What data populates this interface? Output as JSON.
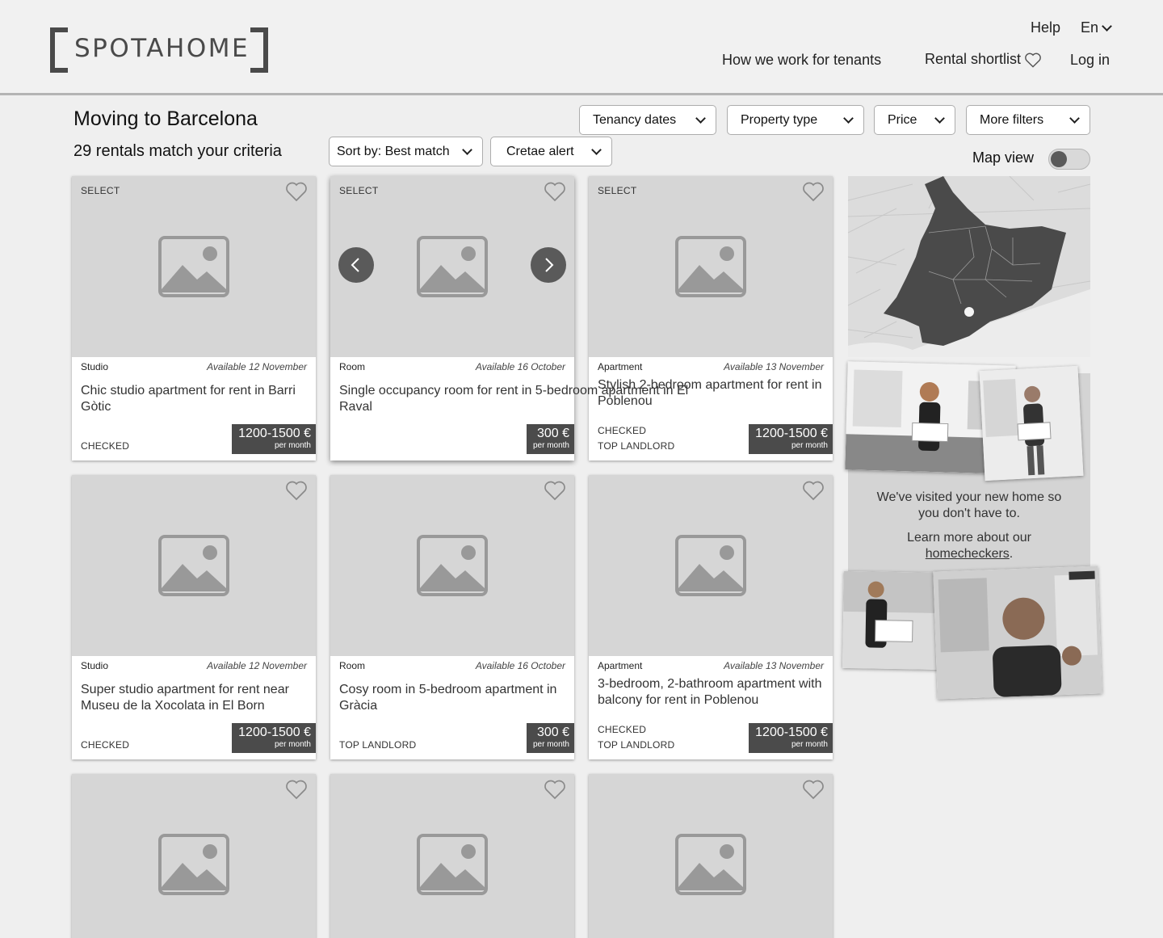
{
  "brand": {
    "logo_text": "SPOTAHOME"
  },
  "header": {
    "help": "Help",
    "language": "En",
    "how_we_work": "How we work for tenants",
    "shortlist": "Rental shortlist",
    "login": "Log in"
  },
  "toolbar": {
    "title": "Moving to Barcelona",
    "result_count": "29 rentals match your criteria",
    "filters": {
      "tenancy_dates": "Tenancy dates",
      "property_type": "Property type",
      "price": "Price",
      "more_filters": "More filters"
    },
    "sort_label": "Sort by: Best match",
    "alert_label": "Cretae alert",
    "map_view_label": "Map view",
    "map_view_on": false
  },
  "listings": [
    {
      "select": "SELECT",
      "type": "Studio",
      "available": "Available 12 November",
      "title": "Chic studio apartment for rent in Barri Gòtic",
      "tags": [
        "CHECKED"
      ],
      "price": "1200-1500 €",
      "per": "per month"
    },
    {
      "select": "SELECT",
      "type": "Room",
      "available": "Available 16 October",
      "title": "Single occupancy room for rent in 5-bedroom apartment in El Raval",
      "tags": [],
      "price": "300 €",
      "per": "per month"
    },
    {
      "select": "SELECT",
      "type": "Apartment",
      "available": "Available 13 November",
      "title": "Stylish 2-bedroom apartment for rent in Poblenou",
      "tags": [
        "CHECKED",
        "TOP LANDLORD"
      ],
      "price": "1200-1500 €",
      "per": "per month"
    },
    {
      "select": "",
      "type": "Studio",
      "available": "Available 12 November",
      "title": "Super studio apartment for rent near Museu de la Xocolata in El Born",
      "tags": [
        "CHECKED"
      ],
      "price": "1200-1500 €",
      "per": "per month"
    },
    {
      "select": "",
      "type": "Room",
      "available": "Available 16 October",
      "title": "Cosy room in 5-bedroom apartment in Gràcia",
      "tags": [
        "TOP LANDLORD"
      ],
      "price": "300 €",
      "per": "per month"
    },
    {
      "select": "",
      "type": "Apartment",
      "available": "Available 13 November",
      "title": "3-bedroom, 2-bathroom apartment with balcony for rent in Poblenou",
      "tags": [
        "CHECKED",
        "TOP LANDLORD"
      ],
      "price": "1200-1500 €",
      "per": "per month"
    }
  ],
  "promo": {
    "line1": "We've visited your new home so you don't have to.",
    "line2_prefix": "Learn more about our",
    "link": "homecheckers",
    "line2_suffix": "."
  }
}
